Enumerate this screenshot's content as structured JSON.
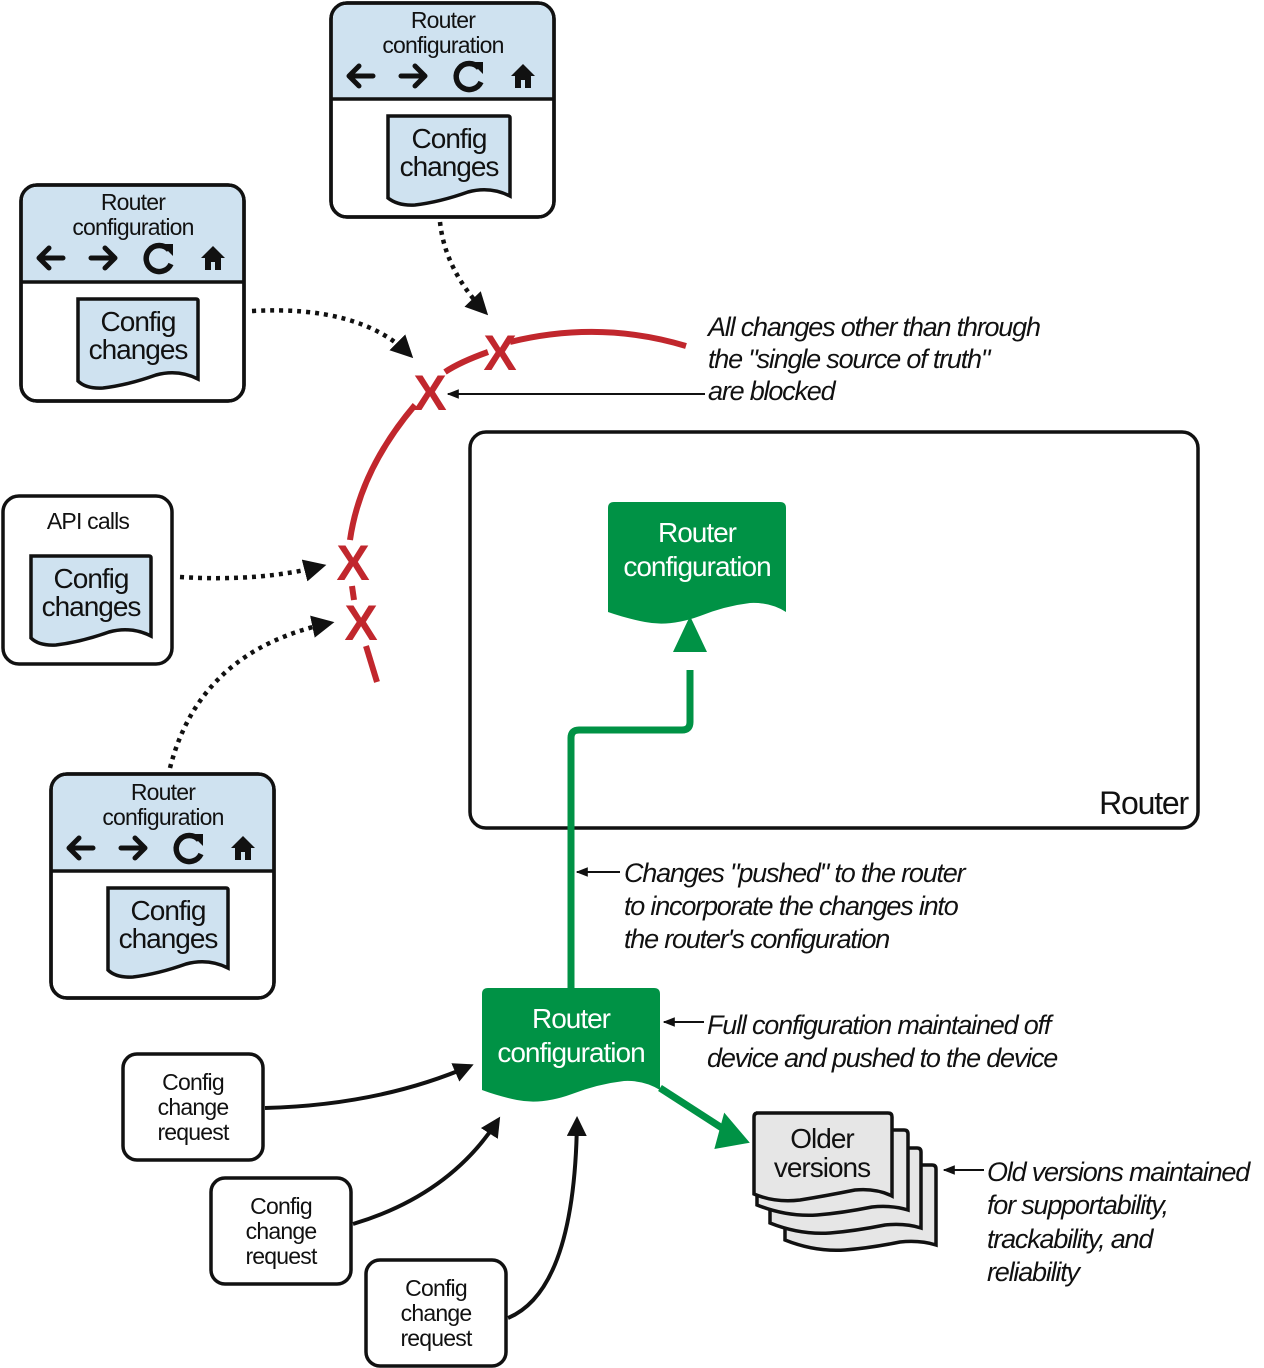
{
  "colors": {
    "blocked": "#c1272d",
    "source_of_truth": "#009245",
    "panel_header": "#cfe2f0",
    "older_versions": "#e6e6e6"
  },
  "ui_panels": [
    {
      "title_line1": "Router",
      "title_line2": "configuration",
      "icons": [
        "back-arrow-icon",
        "forward-arrow-icon",
        "refresh-icon",
        "home-icon"
      ],
      "doc_line1": "Config",
      "doc_line2": "changes"
    },
    {
      "title_line1": "Router",
      "title_line2": "configuration",
      "icons": [
        "back-arrow-icon",
        "forward-arrow-icon",
        "refresh-icon",
        "home-icon"
      ],
      "doc_line1": "Config",
      "doc_line2": "changes"
    },
    {
      "title_line1": "Router",
      "title_line2": "configuration",
      "icons": [
        "back-arrow-icon",
        "forward-arrow-icon",
        "refresh-icon",
        "home-icon"
      ],
      "doc_line1": "Config",
      "doc_line2": "changes"
    }
  ],
  "api_box": {
    "title": "API calls",
    "doc_line1": "Config",
    "doc_line2": "changes"
  },
  "blocked_marks": [
    "X",
    "X",
    "X",
    "X"
  ],
  "notes": {
    "blocked": [
      "All changes other than through",
      "the \"single source of truth\"",
      "are blocked"
    ],
    "pushed": [
      "Changes \"pushed\" to the router",
      "to incorporate the changes into",
      "the router's configuration"
    ],
    "full_config": [
      "Full configuration maintained off",
      "device and pushed to the device"
    ],
    "old_versions": [
      "Old versions maintained",
      "for supportability,",
      "trackability, and",
      "reliability"
    ]
  },
  "router": {
    "label": "Router",
    "config_line1": "Router",
    "config_line2": "configuration"
  },
  "master_config": {
    "line1": "Router",
    "line2": "configuration"
  },
  "older_versions": {
    "line1": "Older",
    "line2": "versions"
  },
  "requests": [
    {
      "line1": "Config",
      "line2": "change",
      "line3": "request"
    },
    {
      "line1": "Config",
      "line2": "change",
      "line3": "request"
    },
    {
      "line1": "Config",
      "line2": "change",
      "line3": "request"
    }
  ]
}
